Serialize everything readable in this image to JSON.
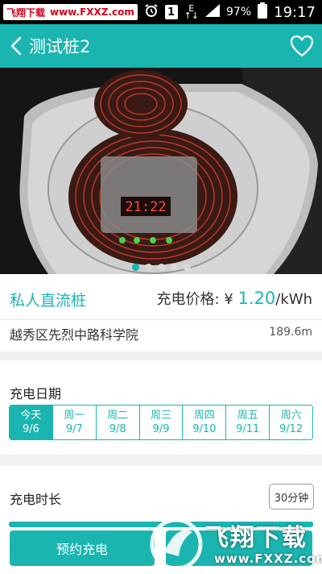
{
  "status_bar": {
    "watermark_left": "飞翔下载",
    "watermark_url": "www.FXXZ.com",
    "sim_label": "1",
    "network_label": "E",
    "battery": "97%",
    "time": "19:17"
  },
  "header": {
    "title": "测试桩2",
    "back_icon": "chevron-left-icon",
    "favorite_icon": "heart-outline-icon"
  },
  "carousel": {
    "display_time": "21:22",
    "dots": [
      true,
      false,
      false,
      false,
      false
    ],
    "active_color": "#1ab5b0"
  },
  "station": {
    "pile_type": "私人直流桩",
    "price_label": "充电价格:",
    "price_currency": "¥",
    "price_value": "1.20",
    "price_unit": "/kWh",
    "address": "越秀区先烈中路科学院",
    "distance": "189.6m"
  },
  "date_picker": {
    "label": "充电日期",
    "days": [
      {
        "weekday": "今天",
        "date": "9/6",
        "active": true
      },
      {
        "weekday": "周一",
        "date": "9/7",
        "active": false
      },
      {
        "weekday": "周二",
        "date": "9/8",
        "active": false
      },
      {
        "weekday": "周三",
        "date": "9/9",
        "active": false
      },
      {
        "weekday": "周四",
        "date": "9/10",
        "active": false
      },
      {
        "weekday": "周五",
        "date": "9/11",
        "active": false
      },
      {
        "weekday": "周六",
        "date": "9/12",
        "active": false
      }
    ]
  },
  "duration": {
    "label": "充电时长",
    "selected": "30分钟"
  },
  "actions": {
    "reserve_label": "预约充电"
  },
  "watermark": {
    "logo_text": "飞翔下载",
    "domain": "www.FXXZ.com"
  },
  "colors": {
    "accent": "#1ab5b0"
  }
}
